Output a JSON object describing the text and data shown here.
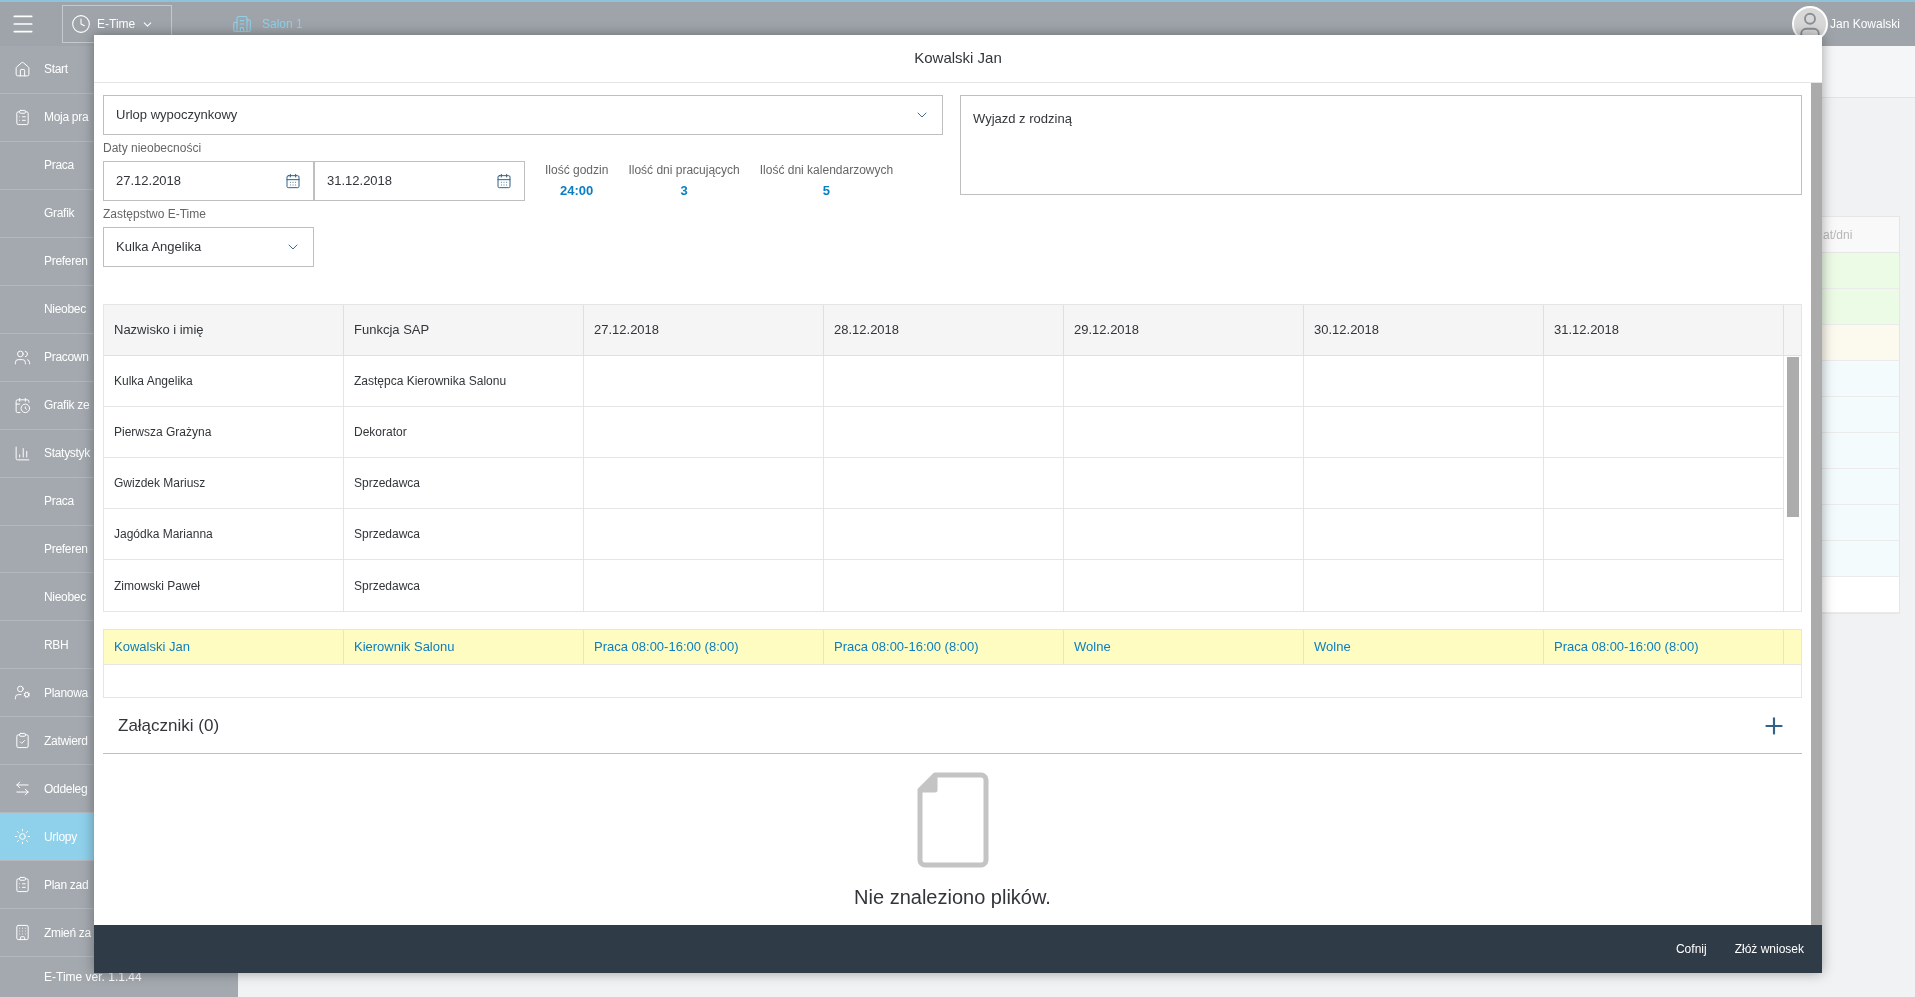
{
  "top_bar": {
    "app_switch": "E-Time",
    "location": "Salon 1",
    "user_name": "Jan Kowalski"
  },
  "sidebar": {
    "items": [
      {
        "label": "Start",
        "kind": "main",
        "selected": false
      },
      {
        "label": "Moja pra",
        "kind": "main",
        "selected": false
      },
      {
        "label": "Praca",
        "kind": "sub",
        "selected": false
      },
      {
        "label": "Grafik",
        "kind": "sub",
        "selected": false
      },
      {
        "label": "Preferen",
        "kind": "sub",
        "selected": false
      },
      {
        "label": "Nieobec",
        "kind": "sub",
        "selected": false
      },
      {
        "label": "Pracown",
        "kind": "main",
        "selected": false
      },
      {
        "label": "Grafik ze",
        "kind": "main",
        "selected": false
      },
      {
        "label": "Statystyk",
        "kind": "main",
        "selected": false
      },
      {
        "label": "Praca",
        "kind": "sub",
        "selected": false
      },
      {
        "label": "Preferen",
        "kind": "sub",
        "selected": false
      },
      {
        "label": "Nieobec",
        "kind": "sub",
        "selected": false
      },
      {
        "label": "RBH",
        "kind": "sub",
        "selected": false
      },
      {
        "label": "Planowa",
        "kind": "main",
        "selected": false
      },
      {
        "label": "Zatwierd",
        "kind": "main",
        "selected": false
      },
      {
        "label": "Oddeleg",
        "kind": "main",
        "selected": false
      },
      {
        "label": "Urlopy",
        "kind": "main",
        "selected": true
      },
      {
        "label": "Plan zad",
        "kind": "main",
        "selected": false
      },
      {
        "label": "Zmień za",
        "kind": "main",
        "selected": false
      }
    ],
    "version": "E-Time ver. 1.1.44"
  },
  "background_table": {
    "header": "at/dni",
    "rows": [
      {
        "color": "#ecfbe6"
      },
      {
        "color": "#ecfbe6"
      },
      {
        "color": "#fcf9ef"
      },
      {
        "color": "#f3fbfd"
      },
      {
        "color": "#f3fbfd"
      },
      {
        "color": "#f3fbfd"
      },
      {
        "color": "#f3fbfd"
      },
      {
        "color": "#f3fbfd"
      },
      {
        "color": "#f3fbfd"
      },
      {
        "color": "#ffffff"
      }
    ]
  },
  "dialog": {
    "title": "Kowalski Jan",
    "absence_type": "Urlop wypoczynkowy",
    "dates_label": "Daty nieobecności",
    "date_from": "27.12.2018",
    "date_to": "31.12.2018",
    "stats": [
      {
        "label": "Ilość godzin",
        "value": "24:00"
      },
      {
        "label": "Ilość dni pracujących",
        "value": "3"
      },
      {
        "label": "Ilość dni kalendarzowych",
        "value": "5"
      }
    ],
    "substitute_label": "Zastępstwo E-Time",
    "substitute": "Kulka Angelika",
    "comment": "Wyjazd z rodziną",
    "table": {
      "columns": [
        "Nazwisko i imię",
        "Funkcja SAP",
        "27.12.2018",
        "28.12.2018",
        "29.12.2018",
        "30.12.2018",
        "31.12.2018"
      ],
      "rows": [
        [
          "Kulka Angelika",
          "Zastępca Kierownika Salonu",
          "",
          "",
          "",
          "",
          ""
        ],
        [
          "Pierwsza Grażyna",
          "Dekorator",
          "",
          "",
          "",
          "",
          ""
        ],
        [
          "Gwizdek Mariusz",
          "Sprzedawca",
          "",
          "",
          "",
          "",
          ""
        ],
        [
          "Jagódka Marianna",
          "Sprzedawca",
          "",
          "",
          "",
          "",
          ""
        ],
        [
          "Zimowski Paweł",
          "Sprzedawca",
          "",
          "",
          "",
          "",
          ""
        ]
      ],
      "own_row": [
        "Kowalski Jan",
        "Kierownik Salonu",
        "Praca 08:00-16:00 (8:00)",
        "Praca 08:00-16:00 (8:00)",
        "Wolne",
        "Wolne",
        "Praca 08:00-16:00 (8:00)"
      ]
    },
    "attachments": {
      "title": "Załączniki (0)",
      "empty_text": "Nie znaleziono plików."
    },
    "footer_buttons": [
      "Cofnij",
      "Złóż wniosek"
    ]
  }
}
